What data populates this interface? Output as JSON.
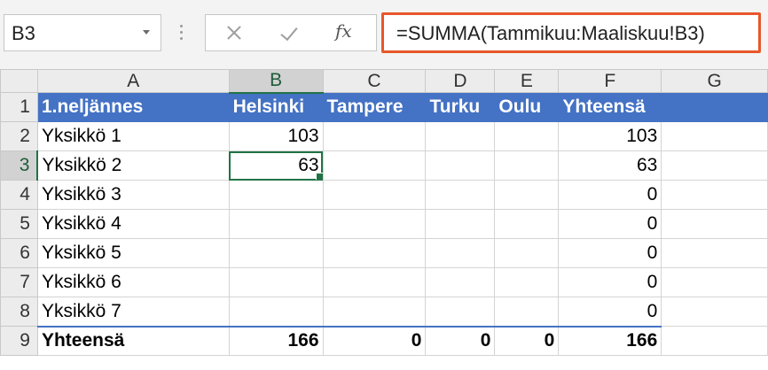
{
  "name_box": {
    "value": "B3"
  },
  "formula_bar": {
    "fx_label": "fx",
    "formula": "=SUMMA(Tammikuu:Maaliskuu!B3)"
  },
  "columns": [
    "A",
    "B",
    "C",
    "D",
    "E",
    "F",
    "G"
  ],
  "selected_cell": {
    "column": "B",
    "row": "3"
  },
  "rows": [
    {
      "row": "1",
      "cells": [
        "1.neljännes",
        "Helsinki",
        "Tampere",
        "Turku",
        "Oulu",
        "Yhteensä",
        ""
      ]
    },
    {
      "row": "2",
      "cells": [
        "Yksikkö 1",
        "103",
        "",
        "",
        "",
        "103",
        ""
      ]
    },
    {
      "row": "3",
      "cells": [
        "Yksikkö 2",
        "63",
        "",
        "",
        "",
        "63",
        ""
      ]
    },
    {
      "row": "4",
      "cells": [
        "Yksikkö 3",
        "",
        "",
        "",
        "",
        "0",
        ""
      ]
    },
    {
      "row": "5",
      "cells": [
        "Yksikkö 4",
        "",
        "",
        "",
        "",
        "0",
        ""
      ]
    },
    {
      "row": "6",
      "cells": [
        "Yksikkö 5",
        "",
        "",
        "",
        "",
        "0",
        ""
      ]
    },
    {
      "row": "7",
      "cells": [
        "Yksikkö 6",
        "",
        "",
        "",
        "",
        "0",
        ""
      ]
    },
    {
      "row": "8",
      "cells": [
        "Yksikkö 7",
        "",
        "",
        "",
        "",
        "0",
        ""
      ]
    },
    {
      "row": "9",
      "cells": [
        "Yhteensä",
        "166",
        "0",
        "0",
        "0",
        "166",
        ""
      ]
    }
  ],
  "colors": {
    "header_fill": "#4472c4",
    "selection": "#217346",
    "formula_highlight": "#e8572a"
  }
}
